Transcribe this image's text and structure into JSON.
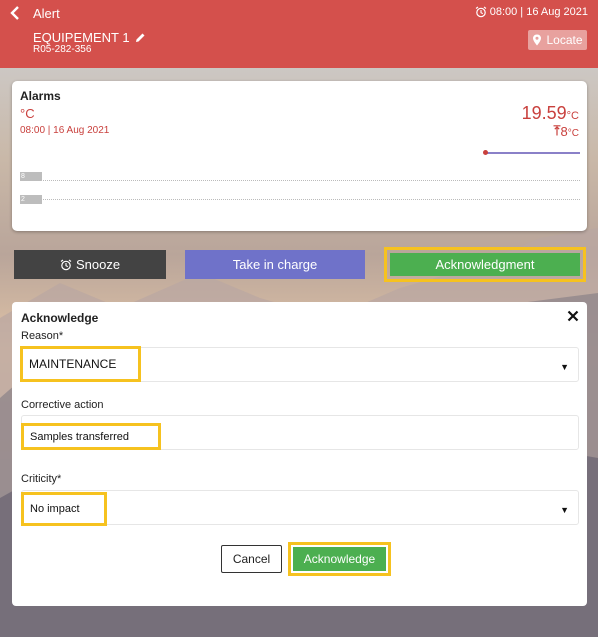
{
  "header": {
    "title": "Alert",
    "alarm_time": "08:00 | 16 Aug 2021",
    "equipment_name": "EQUIPEMENT 1",
    "serial": "R05-282-356",
    "locate_label": "Locate"
  },
  "alarms_card": {
    "title": "Alarms",
    "unit": "°C",
    "time": "08:00 | 16 Aug 2021",
    "current_value": "19.59",
    "current_unit": "°C",
    "threshold_value": "8",
    "threshold_unit": "°C",
    "tick_labels": [
      "8",
      "2"
    ]
  },
  "actions": {
    "snooze_label": "Snooze",
    "take_in_charge_label": "Take in charge",
    "acknowledgment_label": "Acknowledgment"
  },
  "acknowledge_panel": {
    "title": "Acknowledge",
    "reason_label": "Reason*",
    "reason_value": "MAINTENANCE",
    "corrective_label": "Corrective action",
    "corrective_value": "Samples transferred",
    "criticity_label": "Criticity*",
    "criticity_value": "No impact",
    "cancel_label": "Cancel",
    "submit_label": "Acknowledge"
  },
  "colors": {
    "header_red": "#d4504c",
    "alert_red": "#c9403d",
    "take_purple": "#6f72c9",
    "ack_green": "#4caf50",
    "highlight_yellow": "#f6c21f",
    "snooze_dark": "#434343"
  },
  "icons": [
    "chevron-left-icon",
    "alarm-clock-icon",
    "pencil-icon",
    "location-pin-icon",
    "threshold-max-icon",
    "close-icon",
    "caret-down-icon"
  ]
}
